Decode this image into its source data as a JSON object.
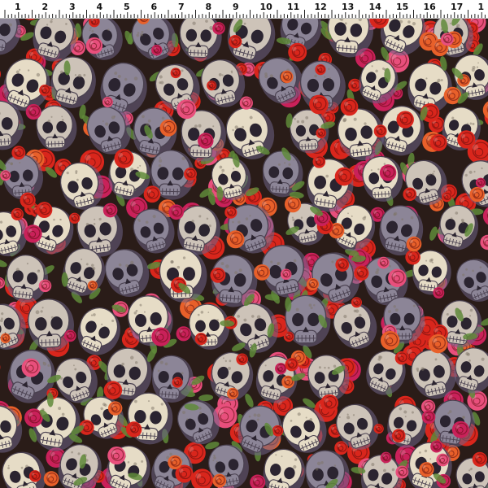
{
  "ruler": {
    "labels": [
      "1",
      "2",
      "3",
      "4",
      "5",
      "6",
      "7",
      "8",
      "9",
      "10",
      "11",
      "12",
      "13",
      "14",
      "15",
      "16",
      "17",
      "1"
    ]
  },
  "fabric": {
    "motifs": [
      "skull",
      "rose",
      "leaf"
    ],
    "colors": {
      "background": "#2a1c18",
      "skull_light": "#e6dcc6",
      "skull_shadow": "#8c8597",
      "skull_violet": "#6e6488",
      "eye_socket": "#2b2430",
      "rose_red": "#d9261c",
      "rose_orange": "#e8602a",
      "rose_pink": "#e84f7c",
      "rose_magenta": "#c9215a",
      "leaf_green": "#5f8a3a"
    }
  }
}
